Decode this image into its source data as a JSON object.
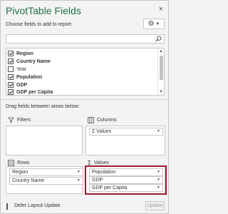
{
  "pane": {
    "title": "PivotTable Fields",
    "close_glyph": "×",
    "choose_label": "Choose fields to add to report:",
    "tools_icon": "gear-icon",
    "search_placeholder": ""
  },
  "fields": [
    {
      "label": "Region",
      "checked": true,
      "bold": true
    },
    {
      "label": "Country Name",
      "checked": true,
      "bold": true
    },
    {
      "label": "Year",
      "checked": false,
      "bold": false
    },
    {
      "label": "Population",
      "checked": true,
      "bold": true
    },
    {
      "label": "GDP",
      "checked": true,
      "bold": true
    },
    {
      "label": "GDP per Capita",
      "checked": true,
      "bold": true
    }
  ],
  "areas": {
    "drag_label": "Drag fields between areas below:",
    "filters": {
      "title": "Filters",
      "items": []
    },
    "columns": {
      "title": "Columns",
      "items": [
        "Σ Values"
      ]
    },
    "rows": {
      "title": "Rows",
      "items": [
        "Region",
        "Country Name"
      ]
    },
    "values": {
      "title": "Values",
      "items": [
        "Population",
        "GDP",
        "GDP per Capita"
      ]
    }
  },
  "footer": {
    "defer_label": "Defer Layout Update",
    "defer_checked": false,
    "update_label": "Update"
  },
  "colors": {
    "title": "#217346",
    "highlight_border": "#9b1b30"
  }
}
